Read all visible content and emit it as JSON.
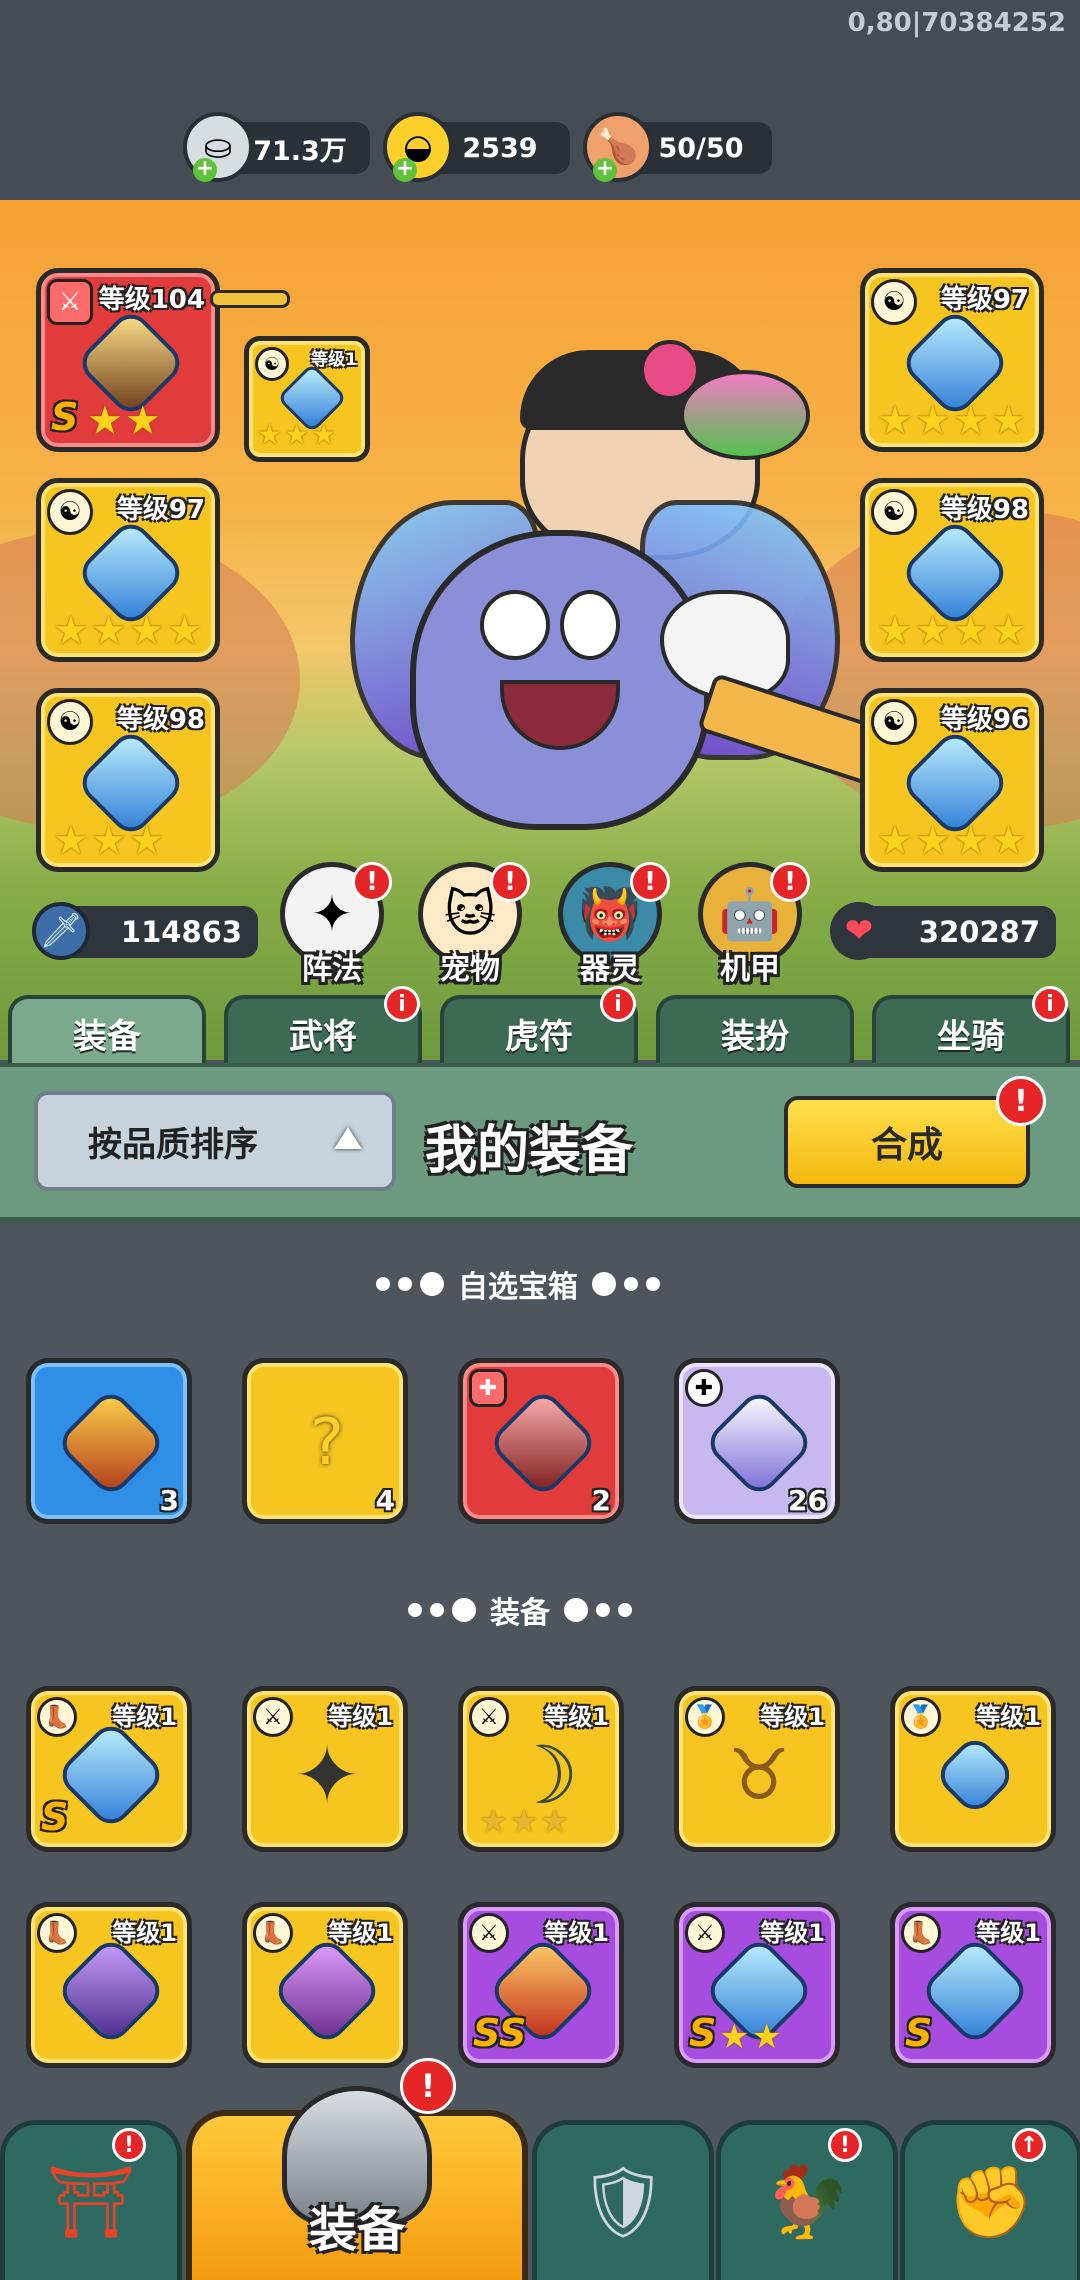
{
  "debug_text": "0,80|70384252",
  "resources": [
    {
      "icon": "silver-coin-icon",
      "value": "71.3万"
    },
    {
      "icon": "gold-ingot-icon",
      "value": "2539"
    },
    {
      "icon": "meat-stamina-icon",
      "value": "50/50"
    }
  ],
  "equipped": {
    "left": [
      {
        "level": "等级104",
        "grade": "S",
        "stars": 2
      },
      {
        "level": "等级97",
        "stars": 4
      },
      {
        "level": "等级98",
        "stars": 3
      }
    ],
    "right": [
      {
        "level": "等级97",
        "stars": 4
      },
      {
        "level": "等级98",
        "stars": 4
      },
      {
        "level": "等级96",
        "stars": 4
      }
    ],
    "small_slot": {
      "level": "等级1",
      "stars": 3
    }
  },
  "stats": {
    "attack": "114863",
    "hp": "320287"
  },
  "features": [
    "阵法",
    "宠物",
    "器灵",
    "机甲"
  ],
  "tabs": [
    "装备",
    "武将",
    "虎符",
    "装扮",
    "坐骑"
  ],
  "panel": {
    "sort_label": "按品质排序",
    "title": "我的装备",
    "combine_label": "合成"
  },
  "sections": {
    "chests_title": "自选宝箱",
    "equip_title": "装备"
  },
  "chests": [
    {
      "count": "3"
    },
    {
      "count": "4"
    },
    {
      "count": "2"
    },
    {
      "count": "26"
    }
  ],
  "inventory_row1": [
    {
      "level": "等级1",
      "grade": "S"
    },
    {
      "level": "等级1"
    },
    {
      "level": "等级1",
      "stars": 3
    },
    {
      "level": "等级1"
    },
    {
      "level": "等级1"
    }
  ],
  "inventory_row2": [
    {
      "level": "等级1"
    },
    {
      "level": "等级1"
    },
    {
      "level": "等级1",
      "grade": "SS"
    },
    {
      "level": "等级1",
      "grade": "S",
      "stars": 2
    },
    {
      "level": "等级1",
      "grade": "S"
    }
  ],
  "bottom_nav": {
    "active_label": "装备"
  },
  "colors": {
    "accent": "#f5b80f",
    "alert": "#e62626",
    "panel": "#6b9a80",
    "background": "#4e555d"
  }
}
